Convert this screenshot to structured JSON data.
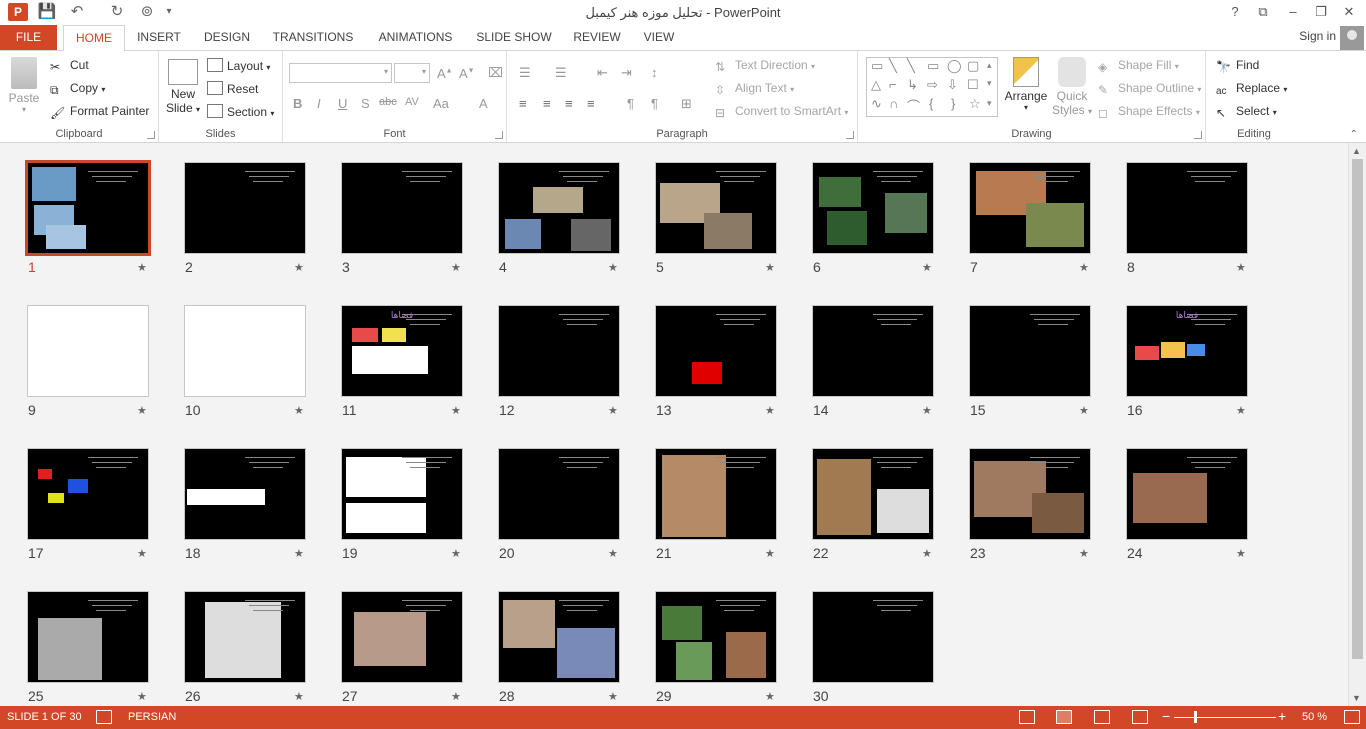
{
  "window": {
    "title": "تحلیل موزه هنر کیمبل - PowerPoint",
    "controls": [
      "?",
      "⧉",
      "–",
      "❐",
      "✕"
    ]
  },
  "quick_access": [
    "save-icon",
    "undo-icon",
    "redo-icon",
    "present-icon",
    "customize-icon"
  ],
  "tabs": [
    "FILE",
    "HOME",
    "INSERT",
    "DESIGN",
    "TRANSITIONS",
    "ANIMATIONS",
    "SLIDE SHOW",
    "REVIEW",
    "VIEW"
  ],
  "active_tab": "HOME",
  "account": {
    "sign_in": "Sign in"
  },
  "ribbon": {
    "clipboard": {
      "label": "Clipboard",
      "paste": "Paste",
      "cut": "Cut",
      "copy": "Copy",
      "format_painter": "Format Painter"
    },
    "slides": {
      "label": "Slides",
      "new_slide_1": "New",
      "new_slide_2": "Slide",
      "layout": "Layout",
      "reset": "Reset",
      "section": "Section"
    },
    "font": {
      "label": "Font",
      "font_name": "",
      "font_size": ""
    },
    "paragraph": {
      "label": "Paragraph",
      "text_direction": "Text Direction",
      "align_text": "Align Text",
      "smartart": "Convert to SmartArt"
    },
    "drawing": {
      "label": "Drawing",
      "arrange": "Arrange",
      "quick_styles_1": "Quick",
      "quick_styles_2": "Styles",
      "shape_fill": "Shape Fill",
      "shape_outline": "Shape Outline",
      "shape_effects": "Shape Effects"
    },
    "editing": {
      "label": "Editing",
      "find": "Find",
      "replace": "Replace",
      "select": "Select"
    }
  },
  "slides": [
    {
      "n": "1",
      "star": "★"
    },
    {
      "n": "2",
      "star": "★"
    },
    {
      "n": "3",
      "star": "★"
    },
    {
      "n": "4",
      "star": "★"
    },
    {
      "n": "5",
      "star": "★"
    },
    {
      "n": "6",
      "star": "★"
    },
    {
      "n": "7",
      "star": "★"
    },
    {
      "n": "8",
      "star": "★"
    },
    {
      "n": "9",
      "star": "★"
    },
    {
      "n": "10",
      "star": "★"
    },
    {
      "n": "11",
      "star": "★",
      "title": "فضاها"
    },
    {
      "n": "12",
      "star": "★"
    },
    {
      "n": "13",
      "star": "★"
    },
    {
      "n": "14",
      "star": "★"
    },
    {
      "n": "15",
      "star": "★"
    },
    {
      "n": "16",
      "star": "★",
      "title": "فضاها"
    },
    {
      "n": "17",
      "star": "★"
    },
    {
      "n": "18",
      "star": "★"
    },
    {
      "n": "19",
      "star": "★"
    },
    {
      "n": "20",
      "star": "★"
    },
    {
      "n": "21",
      "star": "★"
    },
    {
      "n": "22",
      "star": "★"
    },
    {
      "n": "23",
      "star": "★"
    },
    {
      "n": "24",
      "star": "★"
    },
    {
      "n": "25",
      "star": "★"
    },
    {
      "n": "26",
      "star": "★"
    },
    {
      "n": "27",
      "star": "★"
    },
    {
      "n": "28",
      "star": "★"
    },
    {
      "n": "29",
      "star": "★"
    },
    {
      "n": "30",
      "star": ""
    }
  ],
  "selected_slide": "1",
  "status": {
    "slide": "SLIDE 1 OF 30",
    "language": "PERSIAN",
    "zoom": "50 %"
  },
  "colors": {
    "accent": "#d24726",
    "selection": "#c9472b"
  }
}
